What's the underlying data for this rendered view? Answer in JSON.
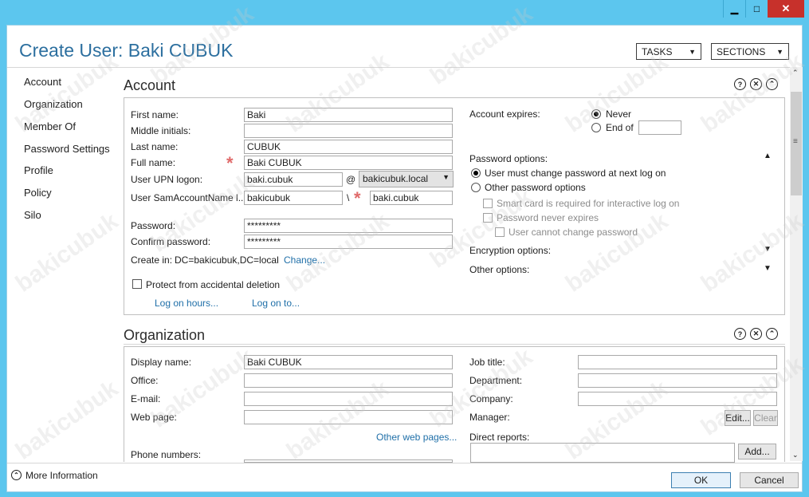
{
  "window": {
    "title": "Create User: Baki CUBUK",
    "controls": {
      "minimize": "▁",
      "maximize": "□",
      "close": "✕"
    }
  },
  "header": {
    "tasks_label": "TASKS",
    "sections_label": "SECTIONS"
  },
  "sidebar": {
    "items": [
      {
        "label": "Account"
      },
      {
        "label": "Organization"
      },
      {
        "label": "Member Of"
      },
      {
        "label": "Password Settings"
      },
      {
        "label": "Profile"
      },
      {
        "label": "Policy"
      },
      {
        "label": "Silo"
      }
    ]
  },
  "account": {
    "section_title": "Account",
    "first_name_label": "First name:",
    "first_name_value": "Baki",
    "middle_initials_label": "Middle initials:",
    "middle_initials_value": "",
    "last_name_label": "Last name:",
    "last_name_value": "CUBUK",
    "full_name_label": "Full name:",
    "full_name_value": "Baki CUBUK",
    "upn_label": "User UPN logon:",
    "upn_value": "baki.cubuk",
    "upn_at": "@",
    "upn_domain": "bakicubuk.local",
    "sam_label": "User SamAccountName l...",
    "sam_domain": "bakicubuk",
    "sam_sep": "\\",
    "sam_value": "baki.cubuk",
    "password_label": "Password:",
    "password_value": "*********",
    "confirm_label": "Confirm password:",
    "confirm_value": "*********",
    "create_in_label": "Create in:",
    "create_in_value": "DC=bakicubuk,DC=local",
    "change_link": "Change...",
    "protect_label": "Protect from accidental deletion",
    "logon_hours_link": "Log on hours...",
    "logon_to_link": "Log on to...",
    "expires_label": "Account expires:",
    "never_label": "Never",
    "end_of_label": "End of",
    "password_options_label": "Password options:",
    "must_change_label": "User must change password at next log on",
    "other_options_label": "Other password options",
    "smart_card_label": "Smart card is required for interactive log on",
    "never_expires_label": "Password never expires",
    "cannot_change_label": "User cannot change password",
    "encryption_label": "Encryption options:",
    "other_label": "Other options:"
  },
  "organization": {
    "section_title": "Organization",
    "display_name_label": "Display name:",
    "display_name_value": "Baki CUBUK",
    "office_label": "Office:",
    "email_label": "E-mail:",
    "web_label": "Web page:",
    "other_web_link": "Other web pages...",
    "phone_label": "Phone numbers:",
    "job_title_label": "Job title:",
    "department_label": "Department:",
    "company_label": "Company:",
    "manager_label": "Manager:",
    "edit_button": "Edit...",
    "clear_button": "Clear",
    "direct_reports_label": "Direct reports:",
    "add_button": "Add..."
  },
  "footer": {
    "more_info": "More Information",
    "ok": "OK",
    "cancel": "Cancel"
  },
  "watermark": "bakicubuk",
  "colors": {
    "titlebar": "#5cc6ee",
    "accent": "#2c6f9f",
    "close": "#c7312b",
    "required": "#e06a6a"
  }
}
